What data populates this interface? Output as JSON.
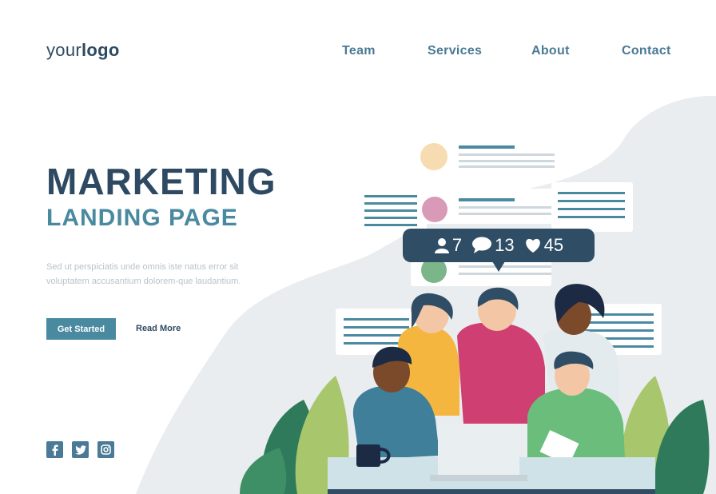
{
  "header": {
    "logo_regular": "your",
    "logo_bold": "logo",
    "nav": [
      "Team",
      "Services",
      "About",
      "Contact"
    ]
  },
  "hero": {
    "title_line1": "MARKETING",
    "title_line2": "LANDING PAGE",
    "description": "Sed ut perspiciatis unde omnis iste natus error sit voluptatem accusantium dolorem-que laudantium.",
    "primary_button": "Get Started",
    "secondary_link": "Read More"
  },
  "stats": {
    "followers": "7",
    "comments": "13",
    "likes": "45"
  },
  "social": {
    "icons": [
      "facebook-icon",
      "twitter-icon",
      "instagram-icon"
    ]
  },
  "colors": {
    "dark_navy": "#2e4a63",
    "teal": "#4a8aa0",
    "nav_text": "#4a7a95",
    "description": "#b9c3c9",
    "background_blob": "#e8ecee",
    "badge": "#2f4e66"
  }
}
